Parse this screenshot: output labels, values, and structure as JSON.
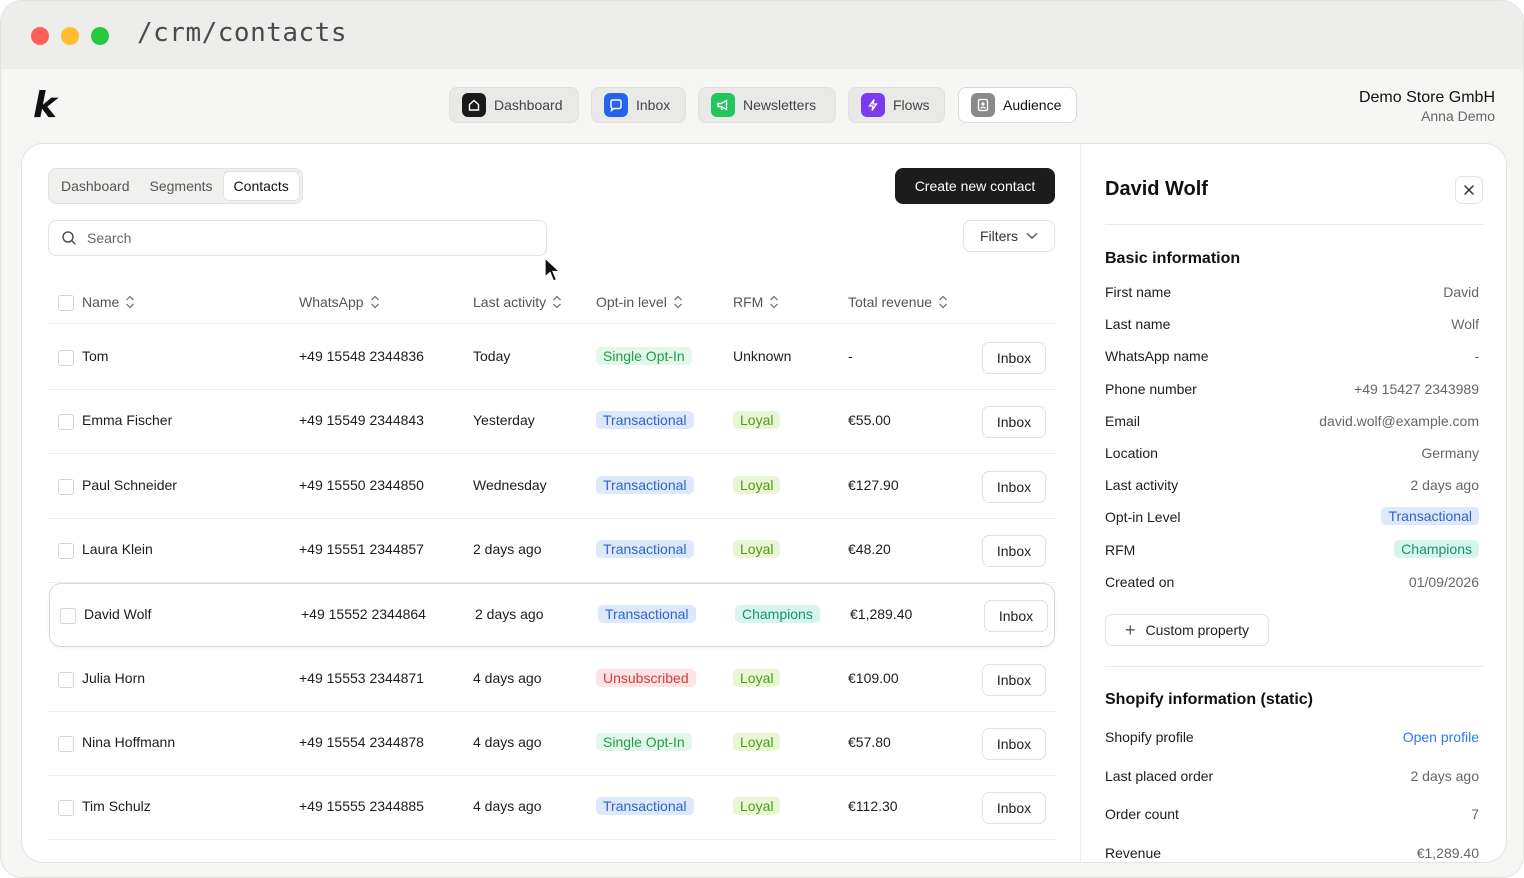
{
  "window": {
    "url": "/crm/contacts"
  },
  "header": {
    "logo": "k",
    "nav": [
      {
        "label": "Dashboard",
        "icon": "home-icon",
        "color": "#1a1a1a"
      },
      {
        "label": "Inbox",
        "icon": "chat-icon",
        "color": "#2563eb"
      },
      {
        "label": "Newsletters",
        "icon": "megaphone-icon",
        "color": "#22c55e"
      },
      {
        "label": "Flows",
        "icon": "lightning-icon",
        "color": "#7c3aed"
      },
      {
        "label": "Audience",
        "icon": "contacts-icon",
        "color": "#8a8a8a"
      }
    ],
    "store_name": "Demo Store GmbH",
    "user_name": "Anna Demo"
  },
  "subtabs": [
    "Dashboard",
    "Segments",
    "Contacts"
  ],
  "actions": {
    "create": "Create new contact",
    "search_placeholder": "Search",
    "filters": "Filters"
  },
  "table": {
    "columns": [
      "Name",
      "WhatsApp",
      "Last activity",
      "Opt-in level",
      "RFM",
      "Total revenue"
    ],
    "inbox_label": "Inbox",
    "rows": [
      {
        "name": "Tom",
        "whatsapp": "+49 15548 2344836",
        "last_activity": "Today",
        "optin": "Single Opt-In",
        "rfm": "Unknown",
        "revenue": "-"
      },
      {
        "name": "Emma Fischer",
        "whatsapp": "+49 15549 2344843",
        "last_activity": "Yesterday",
        "optin": "Transactional",
        "rfm": "Loyal",
        "revenue": "€55.00"
      },
      {
        "name": "Paul Schneider",
        "whatsapp": "+49 15550 2344850",
        "last_activity": "Wednesday",
        "optin": "Transactional",
        "rfm": "Loyal",
        "revenue": "€127.90"
      },
      {
        "name": "Laura Klein",
        "whatsapp": "+49 15551 2344857",
        "last_activity": "2 days ago",
        "optin": "Transactional",
        "rfm": "Loyal",
        "revenue": "€48.20"
      },
      {
        "name": "David Wolf",
        "whatsapp": "+49 15552 2344864",
        "last_activity": "2 days ago",
        "optin": "Transactional",
        "rfm": "Champions",
        "revenue": "€1,289.40"
      },
      {
        "name": "Julia Horn",
        "whatsapp": "+49 15553 2344871",
        "last_activity": "4 days ago",
        "optin": "Unsubscribed",
        "rfm": "Loyal",
        "revenue": "€109.00"
      },
      {
        "name": "Nina Hoffmann",
        "whatsapp": "+49 15554 2344878",
        "last_activity": "4 days ago",
        "optin": "Single Opt-In",
        "rfm": "Loyal",
        "revenue": "€57.80"
      },
      {
        "name": "Tim Schulz",
        "whatsapp": "+49 15555 2344885",
        "last_activity": "4 days ago",
        "optin": "Transactional",
        "rfm": "Loyal",
        "revenue": "€112.30"
      }
    ]
  },
  "pill_styles": {
    "Single Opt-In": {
      "bg": "#e3f8e8",
      "fg": "#1f9d4a"
    },
    "Transactional": {
      "bg": "#dde9fb",
      "fg": "#2f64c8"
    },
    "Unsubscribed": {
      "bg": "#fde3e3",
      "fg": "#d23b3b"
    },
    "Loyal": {
      "bg": "#e9f6d4",
      "fg": "#4f9a1c"
    },
    "Champions": {
      "bg": "#d7f5ec",
      "fg": "#16936e"
    }
  },
  "panel": {
    "title": "David Wolf",
    "basic_title": "Basic information",
    "basic": [
      {
        "label": "First name",
        "value": "David"
      },
      {
        "label": "Last name",
        "value": "Wolf"
      },
      {
        "label": "WhatsApp name",
        "value": "-"
      },
      {
        "label": "Phone number",
        "value": "+49 15427 2343989"
      },
      {
        "label": "Email",
        "value": "david.wolf@example.com"
      },
      {
        "label": "Location",
        "value": "Germany"
      },
      {
        "label": "Last activity",
        "value": "2 days ago"
      },
      {
        "label": "Opt-in Level",
        "value": "Transactional",
        "pill": true
      },
      {
        "label": "RFM",
        "value": "Champions",
        "pill": true
      },
      {
        "label": "Created on",
        "value": "01/09/2026"
      }
    ],
    "custom_property": "Custom property",
    "shopify_title": "Shopify information (static)",
    "shopify": [
      {
        "label": "Shopify profile",
        "value": "Open profile",
        "link": true
      },
      {
        "label": "Last placed order",
        "value": "2 days ago"
      },
      {
        "label": "Order count",
        "value": "7"
      },
      {
        "label": "Revenue",
        "value": "€1,289.40"
      }
    ]
  }
}
